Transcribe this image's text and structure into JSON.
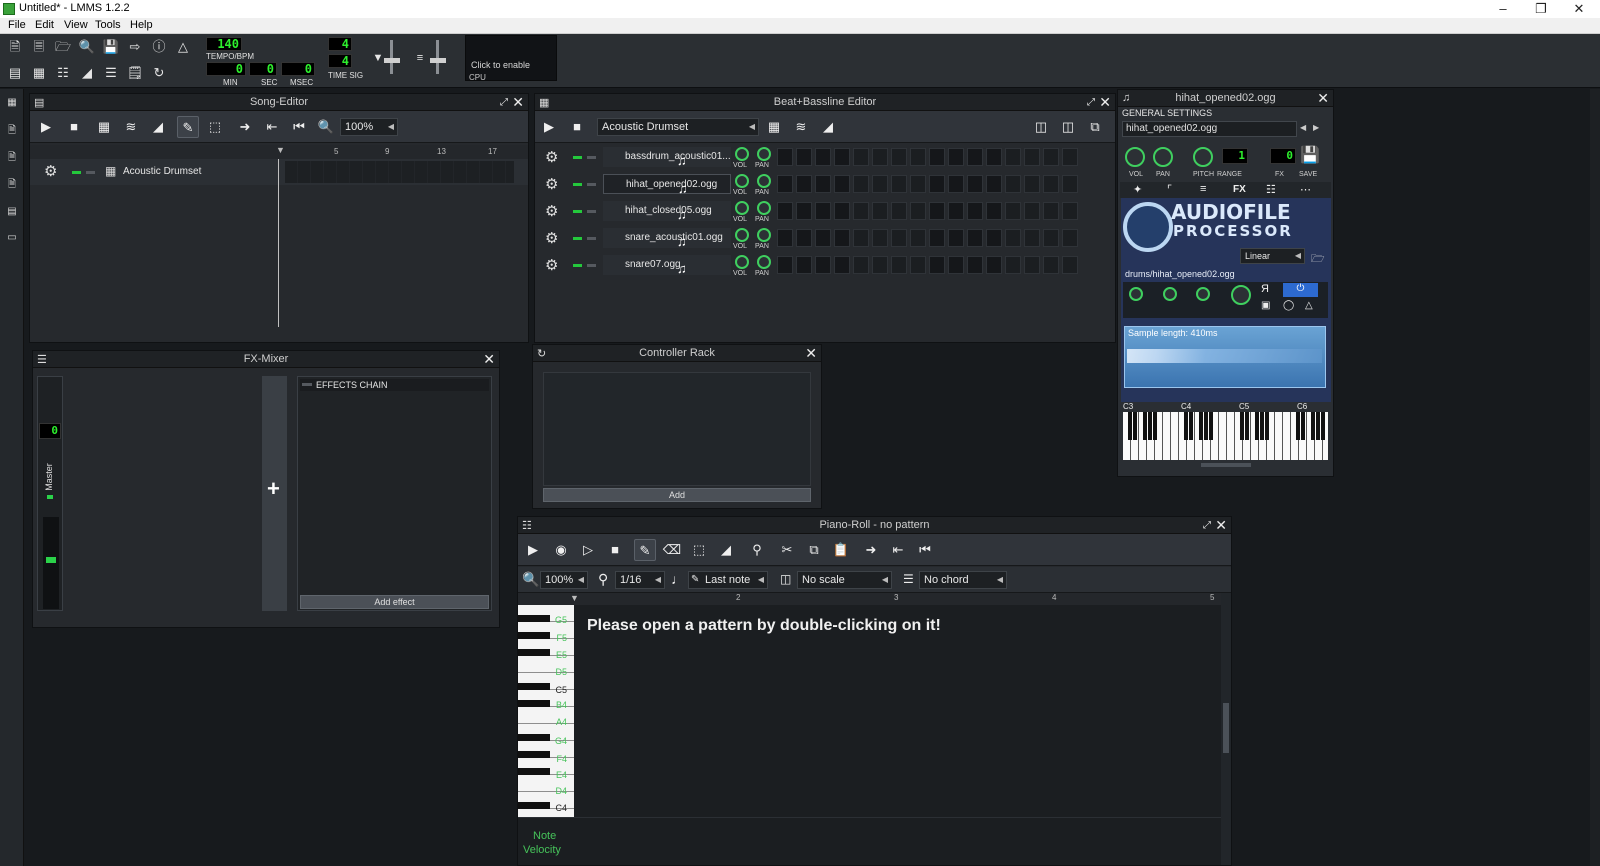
{
  "window": {
    "title": "Untitled* - LMMS 1.2.2"
  },
  "menu": [
    "File",
    "Edit",
    "View",
    "Tools",
    "Help"
  ],
  "toolbar": {
    "tempo_value": "140",
    "tempo_label": "TEMPO/BPM",
    "time_min": "0",
    "time_sec": "0",
    "time_msec": "0",
    "min_label": "MIN",
    "sec_label": "SEC",
    "msec_label": "MSEC",
    "timesig_num": "4",
    "timesig_den": "4",
    "timesig_label": "TIME SIG",
    "cpu_text": "Click to enable",
    "cpu_label": "CPU"
  },
  "song_editor": {
    "title": "Song-Editor",
    "zoom": "100%",
    "bar_markers": [
      "5",
      "9",
      "13",
      "17"
    ],
    "track_name": "Acoustic Drumset"
  },
  "bb_editor": {
    "title": "Beat+Bassline Editor",
    "selected_kit": "Acoustic Drumset",
    "vol_label": "VOL",
    "pan_label": "PAN",
    "tracks": [
      {
        "name": "bassdrum_acoustic01..."
      },
      {
        "name": "hihat_opened02.ogg"
      },
      {
        "name": "hihat_closed05.ogg"
      },
      {
        "name": "snare_acoustic01.ogg"
      },
      {
        "name": "snare07.ogg"
      }
    ]
  },
  "instrument": {
    "title": "hihat_opened02.ogg",
    "general_settings": "GENERAL SETTINGS",
    "name_field": "hihat_opened02.ogg",
    "vol_label": "VOL",
    "pan_label": "PAN",
    "pitch_label": "PITCH",
    "range_label": "RANGE",
    "fx_label": "FX",
    "save_label": "SAVE",
    "fx_tab": "FX",
    "range_value": "1",
    "fx_value": "0",
    "logo_line1": "AUDIOFILE",
    "logo_line2": "PROCESSOR",
    "interp": "Linear",
    "file_path": "drums/hihat_opened02.ogg",
    "sample_length": "Sample length: 410ms",
    "keys": [
      "C3",
      "C4",
      "C5",
      "C6"
    ]
  },
  "fx_mixer": {
    "title": "FX-Mixer",
    "channel_value": "0",
    "master_label": "Master",
    "effects_chain": "EFFECTS CHAIN",
    "add_effect": "Add effect"
  },
  "controller_rack": {
    "title": "Controller Rack",
    "add_label": "Add"
  },
  "piano_roll": {
    "title": "Piano-Roll - no pattern",
    "zoom": "100%",
    "quantize": "1/16",
    "note_length": "Last note",
    "scale": "No scale",
    "chord": "No chord",
    "bar_markers": [
      "2",
      "3",
      "4",
      "5"
    ],
    "message": "Please open a pattern by double-clicking on it!",
    "keys": [
      "G5",
      "F5",
      "E5",
      "D5",
      "C5",
      "B4",
      "A4",
      "G4",
      "F4",
      "E4",
      "D4",
      "C4"
    ],
    "note_label": "Note",
    "velocity_label": "Velocity"
  },
  "colors": {
    "accent_green": "#2df02d",
    "knob_green": "#3fcf5f",
    "bg": "#171a1d"
  }
}
